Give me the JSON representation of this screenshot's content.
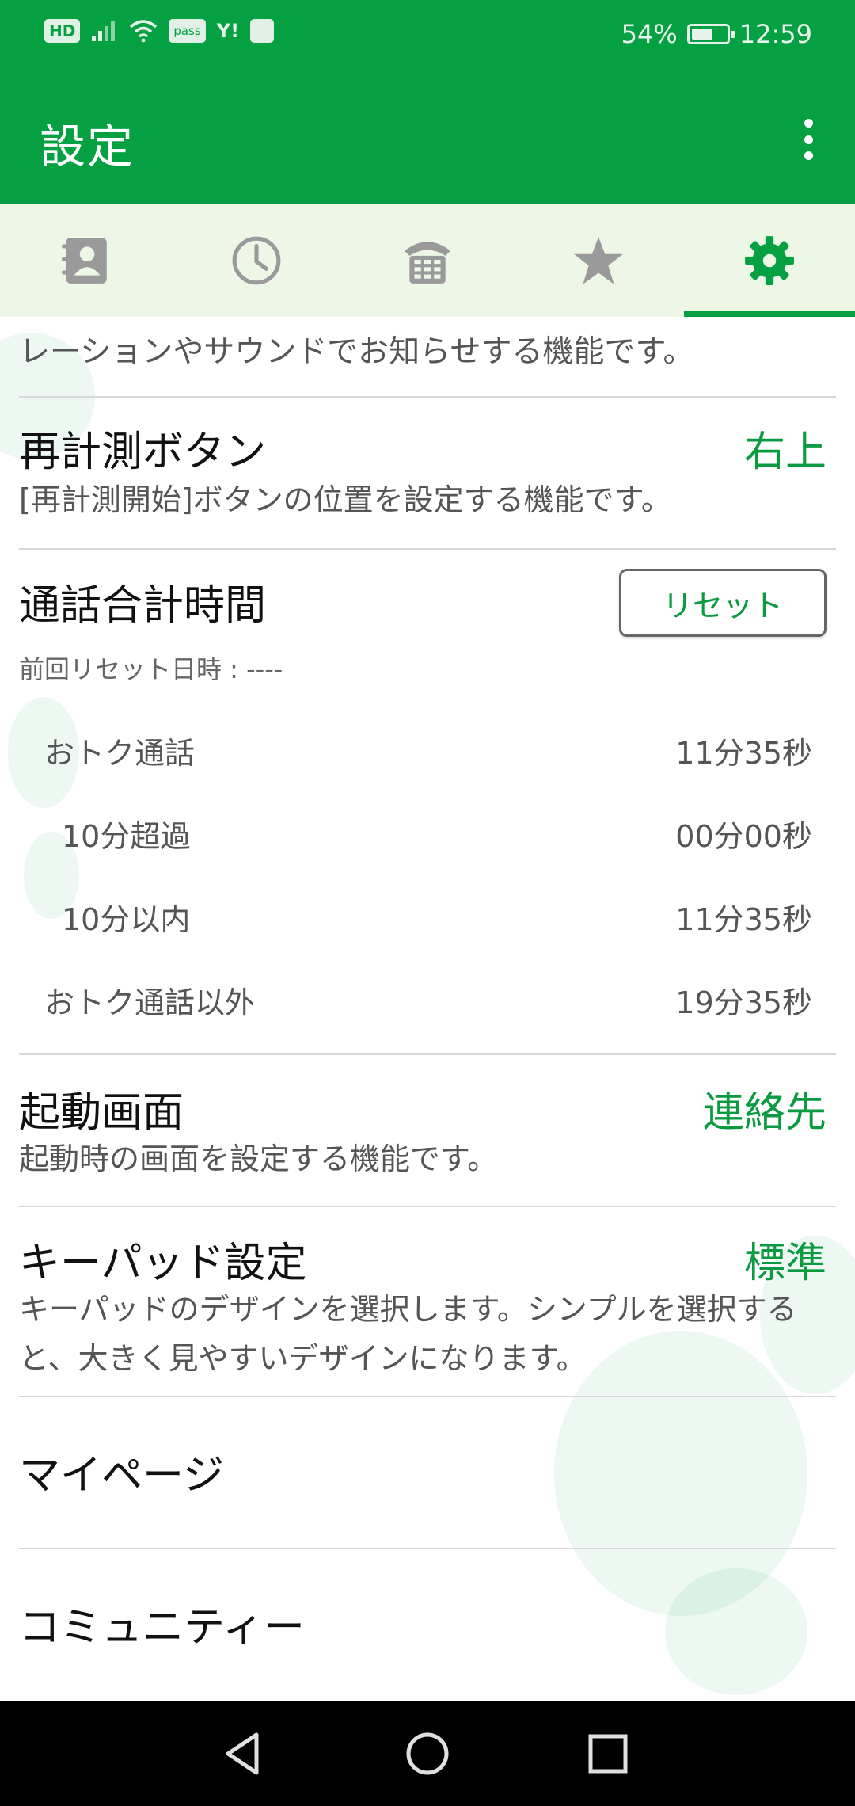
{
  "status_bar": {
    "hd_label": "HD",
    "pass_label": "pass",
    "yahoo_label": "Y!",
    "battery": "54%",
    "battery_level": 0.54,
    "time": "12:59"
  },
  "app_bar": {
    "title": "設定"
  },
  "tabs": [
    {
      "icon": "contacts-icon",
      "active": false
    },
    {
      "icon": "history-clock-icon",
      "active": false
    },
    {
      "icon": "keypad-phone-icon",
      "active": false
    },
    {
      "icon": "star-icon",
      "active": false
    },
    {
      "icon": "gear-icon",
      "active": true
    }
  ],
  "settings": {
    "prev_desc_tail": "レーションやサウンドでお知らせする機能です。",
    "recount_button": {
      "title": "再計測ボタン",
      "value": "右上",
      "desc": "[再計測開始]ボタンの位置を設定する機能です。"
    },
    "total_call_time": {
      "title": "通話合計時間",
      "reset_label": "リセット",
      "last_reset": "前回リセット日時 : ----",
      "stats": [
        {
          "label": "おトク通話",
          "value": "11分35秒"
        },
        {
          "label": "10分超過",
          "value": "00分00秒"
        },
        {
          "label": "10分以内",
          "value": "11分35秒"
        },
        {
          "label": "おトク通話以外",
          "value": "19分35秒"
        }
      ]
    },
    "startup_screen": {
      "title": "起動画面",
      "value": "連絡先",
      "desc": "起動時の画面を設定する機能です。"
    },
    "keypad_setting": {
      "title": "キーパッド設定",
      "value": "標準",
      "desc": "キーパッドのデザインを選択します。シンプルを選択すると、大きく見やすいデザインになります。"
    },
    "my_page": {
      "title": "マイページ"
    },
    "community": {
      "title": "コミュニティー"
    }
  },
  "nav_bar": {
    "back": "back-icon",
    "home": "home-icon",
    "recents": "recents-icon"
  },
  "colors": {
    "brand_green": "#04a041",
    "tab_bg": "#eef7e6",
    "value_green": "#0a9a40"
  }
}
